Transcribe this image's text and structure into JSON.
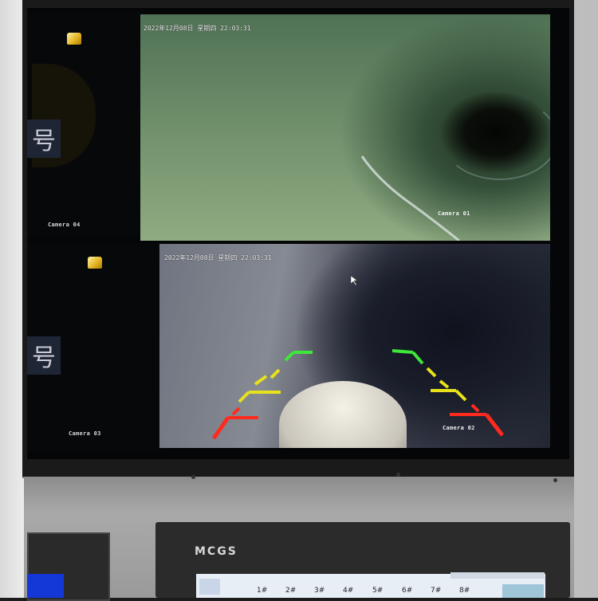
{
  "cameras": {
    "cam01": {
      "label": "Camera 01",
      "osd": "2022年12月08日  星期四  22:03:31"
    },
    "cam02": {
      "label": "Camera 02",
      "osd": "2022年12月08日  星期四  22:03:31"
    },
    "cam03": {
      "label": "Camera 03",
      "hao": "号"
    },
    "cam04": {
      "label": "Camera 04",
      "hao": "号"
    }
  },
  "hmi": {
    "brand": "MCGS",
    "tabs": [
      "1#",
      "2#",
      "3#",
      "4#",
      "5#",
      "6#",
      "7#",
      "8#"
    ]
  },
  "colors": {
    "guide_green": "#3ee83a",
    "guide_yellow": "#e8e21c",
    "guide_red": "#ff2a1e",
    "hmi_blue": "#1438d8"
  }
}
